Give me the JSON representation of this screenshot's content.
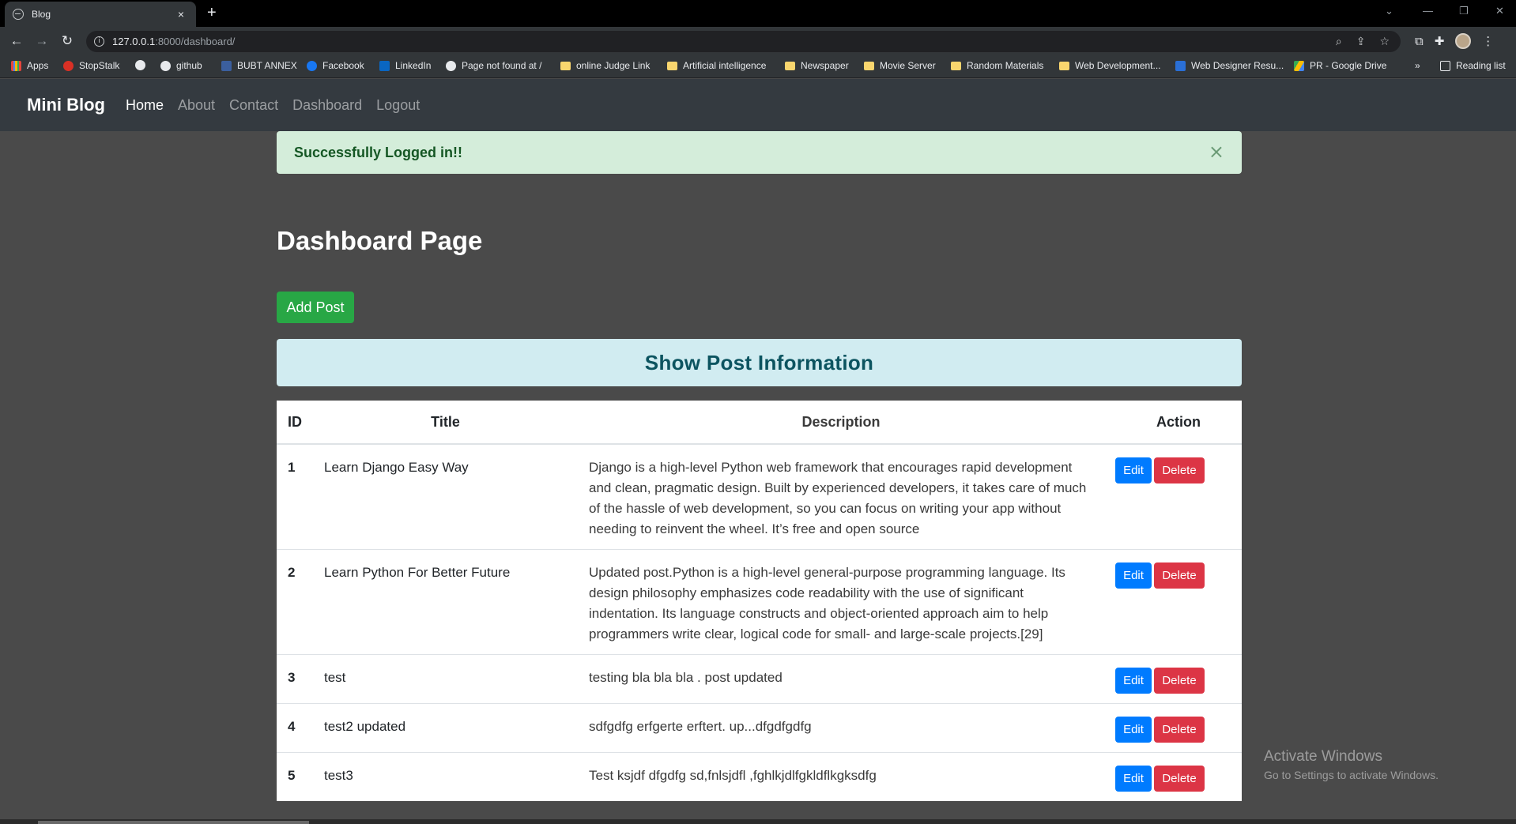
{
  "browser": {
    "tab_title": "Blog",
    "tab_close": "×",
    "new_tab": "+",
    "url_host": "127.0.0.1",
    "url_path": ":8000/dashboard/",
    "bookmarks": [
      {
        "label": "Apps",
        "icon": "apps-grid-icon"
      },
      {
        "label": "StopStalk",
        "icon": "stopstalk-icon"
      },
      {
        "label": "",
        "icon": "globe-icon"
      },
      {
        "label": "github",
        "icon": "github-icon"
      },
      {
        "label": "BUBT ANNEX",
        "icon": "bubt-icon"
      },
      {
        "label": "Facebook",
        "icon": "facebook-icon"
      },
      {
        "label": "LinkedIn",
        "icon": "linkedin-icon"
      },
      {
        "label": "Page not found at /",
        "icon": "globe-icon"
      },
      {
        "label": "online Judge Link",
        "icon": "folder-icon"
      },
      {
        "label": "Artificial intelligence",
        "icon": "folder-icon"
      },
      {
        "label": "Newspaper",
        "icon": "folder-icon"
      },
      {
        "label": "Movie Server",
        "icon": "folder-icon"
      },
      {
        "label": "Random Materials",
        "icon": "folder-icon"
      },
      {
        "label": "Web Development...",
        "icon": "folder-icon"
      },
      {
        "label": "Web Designer Resu...",
        "icon": "bookmark-icon"
      },
      {
        "label": "PR - Google Drive",
        "icon": "google-drive-icon"
      }
    ],
    "more_bookmarks": "»",
    "reading_list": "Reading list"
  },
  "nav": {
    "brand": "Mini Blog",
    "links": [
      "Home",
      "About",
      "Contact",
      "Dashboard",
      "Logout"
    ]
  },
  "alert": {
    "message": "Successfully Logged in!!",
    "close": "×"
  },
  "page": {
    "title": "Dashboard Page",
    "add_button": "Add Post",
    "section_heading": "Show Post Information"
  },
  "table": {
    "headers": {
      "id": "ID",
      "title": "Title",
      "description": "Description",
      "action": "Action"
    },
    "edit_label": "Edit",
    "delete_label": "Delete",
    "rows": [
      {
        "id": "1",
        "title": "Learn Django Easy Way",
        "description": "Django is a high-level Python web framework that encourages rapid development and clean, pragmatic design. Built by experienced developers, it takes care of much of the hassle of web development, so you can focus on writing your app without needing to reinvent the wheel. It’s free and open source"
      },
      {
        "id": "2",
        "title": "Learn Python For Better Future",
        "description": "Updated post.Python is a high-level general-purpose programming language. Its design philosophy emphasizes code readability with the use of significant indentation. Its language constructs and object-oriented approach aim to help programmers write clear, logical code for small- and large-scale projects.[29]"
      },
      {
        "id": "3",
        "title": "test",
        "description": "testing bla bla bla . post updated"
      },
      {
        "id": "4",
        "title": "test2 updated",
        "description": "sdfgdfg erfgerte erftert. up...dfgdfgdfg"
      },
      {
        "id": "5",
        "title": "test3",
        "description": "Test ksjdf dfgdfg sd,fnlsjdfl ,fghlkjdlfgkldflkgksdfg"
      }
    ]
  },
  "watermark": {
    "line1": "Activate Windows",
    "line2": "Go to Settings to activate Windows."
  },
  "colors": {
    "navbar": "#343a40",
    "success_bg": "#d4edda",
    "info_bg": "#d1ecf1",
    "primary": "#007bff",
    "danger": "#dc3545",
    "add": "#28a745"
  }
}
